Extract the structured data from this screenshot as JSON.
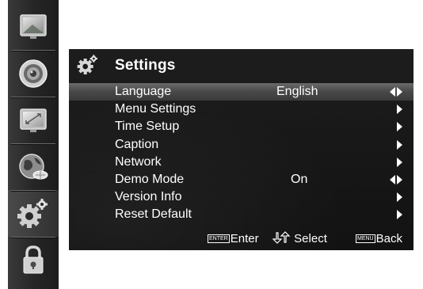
{
  "sidebar": {
    "items": [
      {
        "icon": "picture-icon"
      },
      {
        "icon": "sound-speaker-icon"
      },
      {
        "icon": "screen-adjust-icon"
      },
      {
        "icon": "globe-network-icon"
      },
      {
        "icon": "settings-gear-icon"
      },
      {
        "icon": "lock-icon"
      }
    ],
    "active_index": 4
  },
  "panel": {
    "icon": "settings-gear-icon",
    "title": "Settings"
  },
  "menu": {
    "selected_index": 0,
    "items": [
      {
        "label": "Language",
        "value": "English",
        "arrow": "left-right"
      },
      {
        "label": "Menu Settings",
        "value": "",
        "arrow": "right"
      },
      {
        "label": "Time Setup",
        "value": "",
        "arrow": "right"
      },
      {
        "label": "Caption",
        "value": "",
        "arrow": "right"
      },
      {
        "label": "Network",
        "value": "",
        "arrow": "right"
      },
      {
        "label": "Demo Mode",
        "value": "On",
        "arrow": "left-right"
      },
      {
        "label": "Version Info",
        "value": "",
        "arrow": "right"
      },
      {
        "label": "Reset Default",
        "value": "",
        "arrow": "right"
      }
    ]
  },
  "footer": {
    "enter_key": "ENTER",
    "enter_label": "Enter",
    "select_label": "Select",
    "menu_key": "MENU",
    "back_label": "Back"
  }
}
